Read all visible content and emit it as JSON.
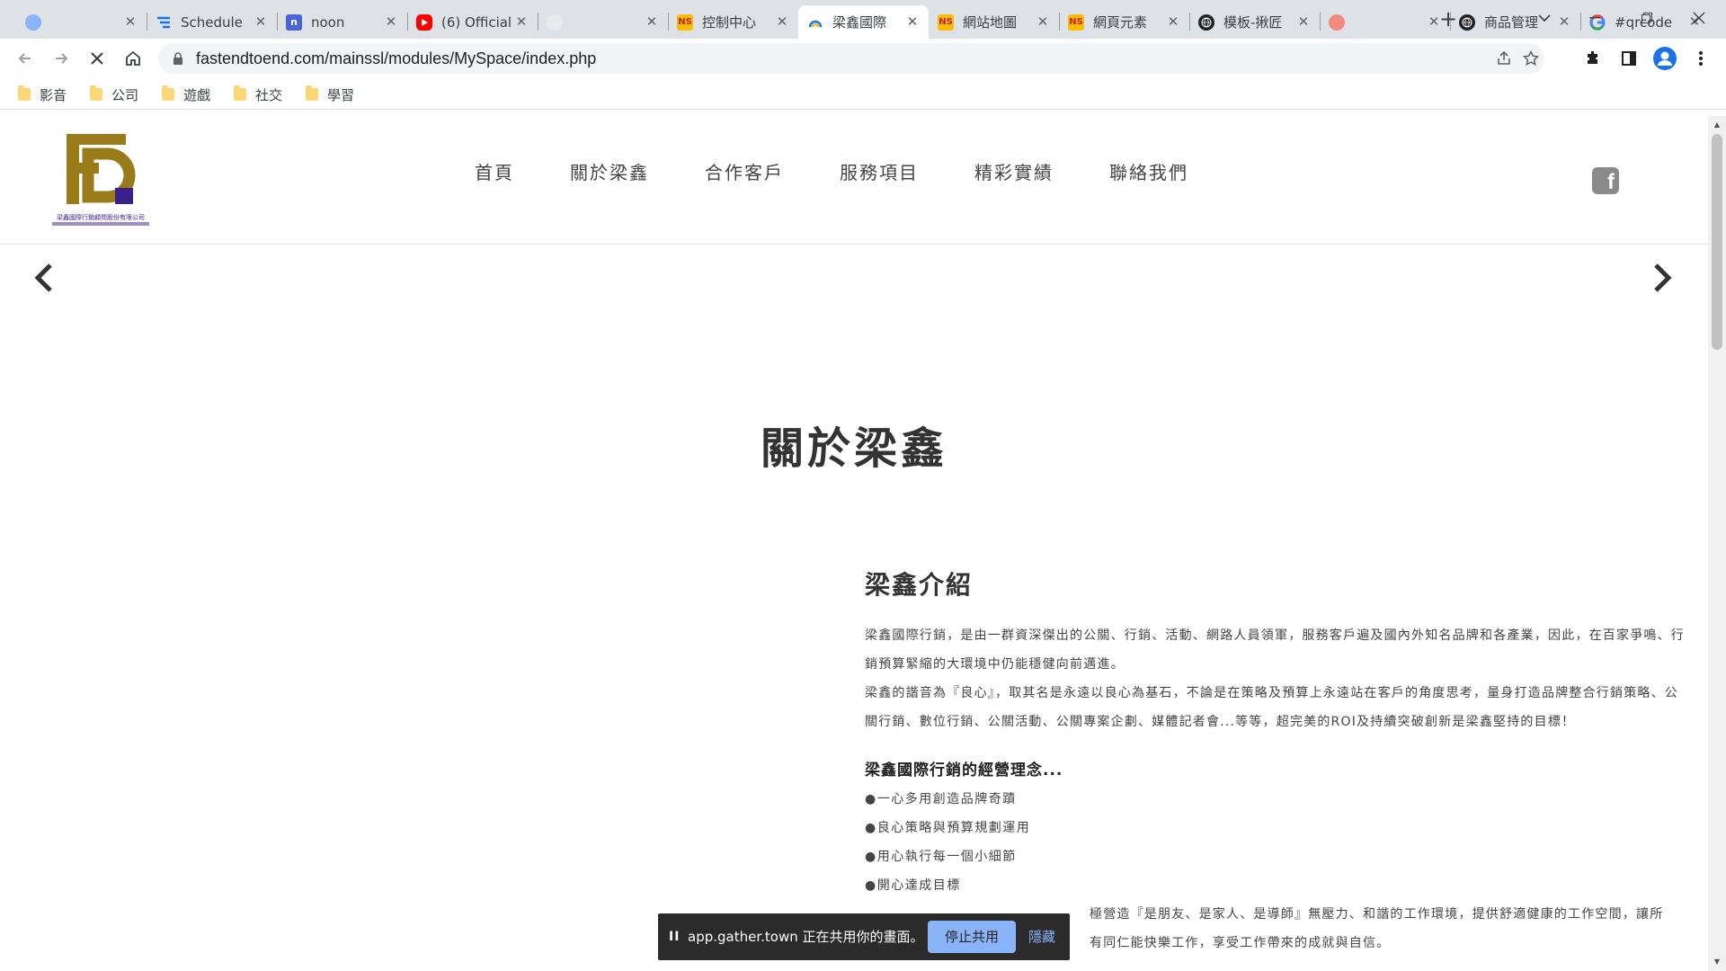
{
  "browser": {
    "tabs": [
      {
        "title": "",
        "icon": "circle-icon",
        "color": "#8ab4f8"
      },
      {
        "title": "Schedule",
        "icon": "schedule-icon",
        "color": "#1a73e8"
      },
      {
        "title": "noon",
        "icon": "noon-icon",
        "color": "#4a64d8"
      },
      {
        "title": "(6) Official",
        "icon": "youtube-icon",
        "color": "#ff0000"
      },
      {
        "title": "",
        "icon": "circle-icon",
        "color": "#e8eaed"
      },
      {
        "title": "控制中心",
        "icon": "ns-icon",
        "color": "#c5221f"
      },
      {
        "title": "梁鑫國際",
        "icon": "site-icon",
        "color": "#1a73e8"
      },
      {
        "title": "網站地圖",
        "icon": "ns-icon",
        "color": "#c5221f"
      },
      {
        "title": "網頁元素",
        "icon": "ns-icon",
        "color": "#c5221f"
      },
      {
        "title": "模板-揪匠",
        "icon": "globe-icon",
        "color": "#202124"
      },
      {
        "title": "",
        "icon": "circle-icon",
        "color": "#f28b82"
      },
      {
        "title": "商品管理",
        "icon": "globe-icon",
        "color": "#202124"
      },
      {
        "title": "#qrcode",
        "icon": "google-icon",
        "color": "#4285f4"
      }
    ],
    "active_tab_index": 6,
    "url": "fastendtoend.com/mainssl/modules/MySpace/index.php",
    "bookmarks": [
      "影音",
      "公司",
      "遊戲",
      "社交",
      "學習"
    ]
  },
  "site": {
    "logo_letters": "FD",
    "logo_caption": "梁鑫國際行銷顧問股份有限公司",
    "nav": [
      "首頁",
      "關於梁鑫",
      "合作客戶",
      "服務項目",
      "精彩實績",
      "聯絡我們"
    ],
    "social": "f",
    "page_title": "關於梁鑫",
    "section_title": "梁鑫介紹",
    "paragraph1": "梁鑫國際行銷，是由一群資深傑出的公關、行銷、活動、網路人員領軍，服務客戶遍及國內外知名品牌和各產業，因此，在百家爭鳴、行銷預算緊縮的大環境中仍能穩健向前邁進。",
    "paragraph2": "梁鑫的諧音為『良心』，取其名是永遠以良心為基石，不論是在策略及預算上永遠站在客戶的角度思考，量身打造品牌整合行銷策略、公關行銷、數位行銷、公關活動、公關專案企劃、媒體記者會...等等，超完美的ROI及持續突破創新是梁鑫堅持的目標！",
    "philosophy_title": "梁鑫國際行銷的經營理念...",
    "bullets": [
      "●一心多用創造品牌奇蹟",
      "●良心策略與預算規劃運用",
      "●用心執行每一個小細節",
      "●開心達成目標"
    ],
    "paragraph3_partial": "極營造『是朋友、是家人、是導師』無壓力、和諧的工作環境，提供舒適健康的工作空間，讓所",
    "paragraph3_partial_line2": "有同仁能快樂工作，享受工作帶來的成就與自信。"
  },
  "sharebar": {
    "pause": "II",
    "message": "app.gather.town 正在共用你的畫面。",
    "stop_label": "停止共用",
    "hide_label": "隱藏"
  }
}
